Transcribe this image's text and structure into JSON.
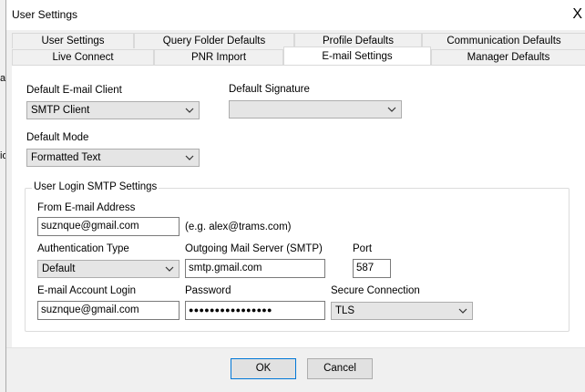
{
  "background": {
    "fragment1": "av",
    "fragment2": "io"
  },
  "dialog": {
    "title": "User Settings",
    "close_glyph": "X"
  },
  "tabs_row1": [
    "User Settings",
    "Query Folder Defaults",
    "Profile Defaults",
    "Communication Defaults"
  ],
  "tabs_row2": [
    "Live Connect",
    "PNR Import",
    "E-mail Settings",
    "Manager Defaults"
  ],
  "active_tab": "E-mail Settings",
  "email": {
    "default_client_label": "Default E-mail Client",
    "default_client_value": "SMTP Client",
    "default_signature_label": "Default Signature",
    "default_signature_value": "",
    "default_mode_label": "Default Mode",
    "default_mode_value": "Formatted Text"
  },
  "smtp": {
    "group_title": "User Login SMTP Settings",
    "from_label": "From E-mail Address",
    "from_value": "suznque@gmail.com",
    "from_hint": "(e.g. alex@trams.com)",
    "auth_label": "Authentication Type",
    "auth_value": "Default",
    "server_label": "Outgoing Mail Server (SMTP)",
    "server_value": "smtp.gmail.com",
    "port_label": "Port",
    "port_value": "587",
    "login_label": "E-mail Account Login",
    "login_value": "suznque@gmail.com",
    "password_label": "Password",
    "password_value": "●●●●●●●●●●●●●●●●",
    "secure_label": "Secure Connection",
    "secure_value": "TLS"
  },
  "buttons": {
    "ok": "OK",
    "cancel": "Cancel"
  }
}
